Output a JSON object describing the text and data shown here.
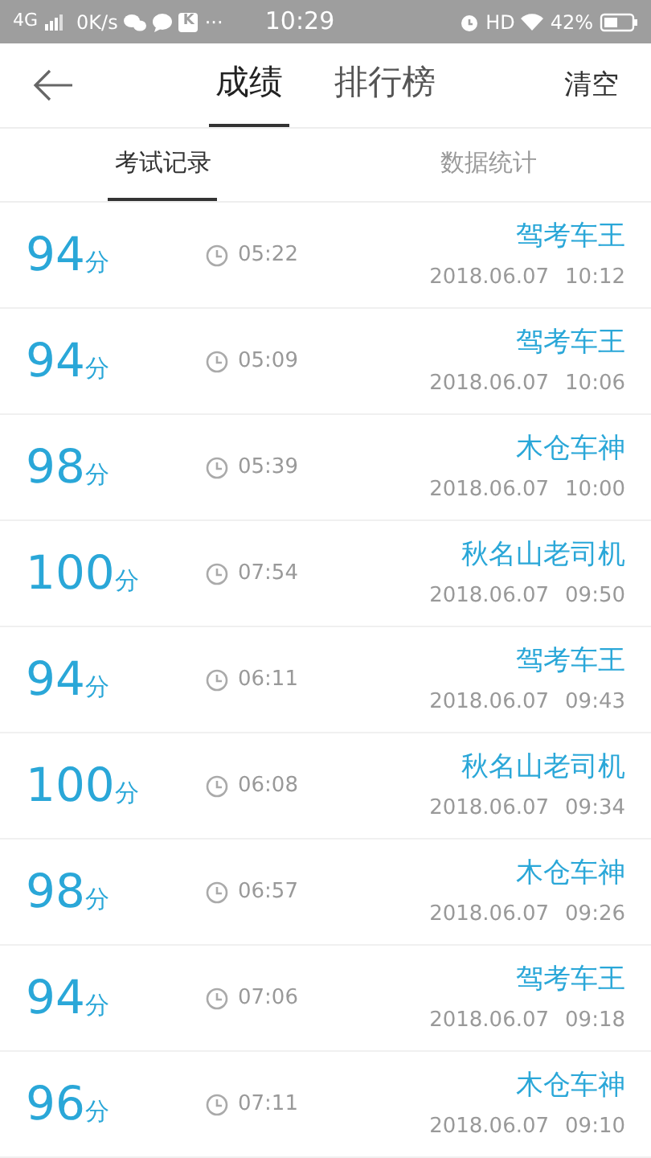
{
  "status_bar": {
    "network": "4G",
    "speed": "0K/s",
    "app_badge": "K",
    "more": "···",
    "time": "10:29",
    "hd": "HD",
    "battery": "42%"
  },
  "header": {
    "tabs": [
      {
        "label": "成绩",
        "selected": true
      },
      {
        "label": "排行榜",
        "selected": false
      }
    ],
    "action": "清空"
  },
  "subtabs": [
    {
      "label": "考试记录",
      "selected": true
    },
    {
      "label": "数据统计",
      "selected": false
    }
  ],
  "records": [
    {
      "score": "94",
      "unit": "分",
      "duration": "05:22",
      "title": "驾考车王",
      "date": "2018.06.07",
      "time": "10:12"
    },
    {
      "score": "94",
      "unit": "分",
      "duration": "05:09",
      "title": "驾考车王",
      "date": "2018.06.07",
      "time": "10:06"
    },
    {
      "score": "98",
      "unit": "分",
      "duration": "05:39",
      "title": "木仓车神",
      "date": "2018.06.07",
      "time": "10:00"
    },
    {
      "score": "100",
      "unit": "分",
      "duration": "07:54",
      "title": "秋名山老司机",
      "date": "2018.06.07",
      "time": "09:50"
    },
    {
      "score": "94",
      "unit": "分",
      "duration": "06:11",
      "title": "驾考车王",
      "date": "2018.06.07",
      "time": "09:43"
    },
    {
      "score": "100",
      "unit": "分",
      "duration": "06:08",
      "title": "秋名山老司机",
      "date": "2018.06.07",
      "time": "09:34"
    },
    {
      "score": "98",
      "unit": "分",
      "duration": "06:57",
      "title": "木仓车神",
      "date": "2018.06.07",
      "time": "09:26"
    },
    {
      "score": "94",
      "unit": "分",
      "duration": "07:06",
      "title": "驾考车王",
      "date": "2018.06.07",
      "time": "09:18"
    },
    {
      "score": "96",
      "unit": "分",
      "duration": "07:11",
      "title": "木仓车神",
      "date": "2018.06.07",
      "time": "09:10"
    }
  ]
}
